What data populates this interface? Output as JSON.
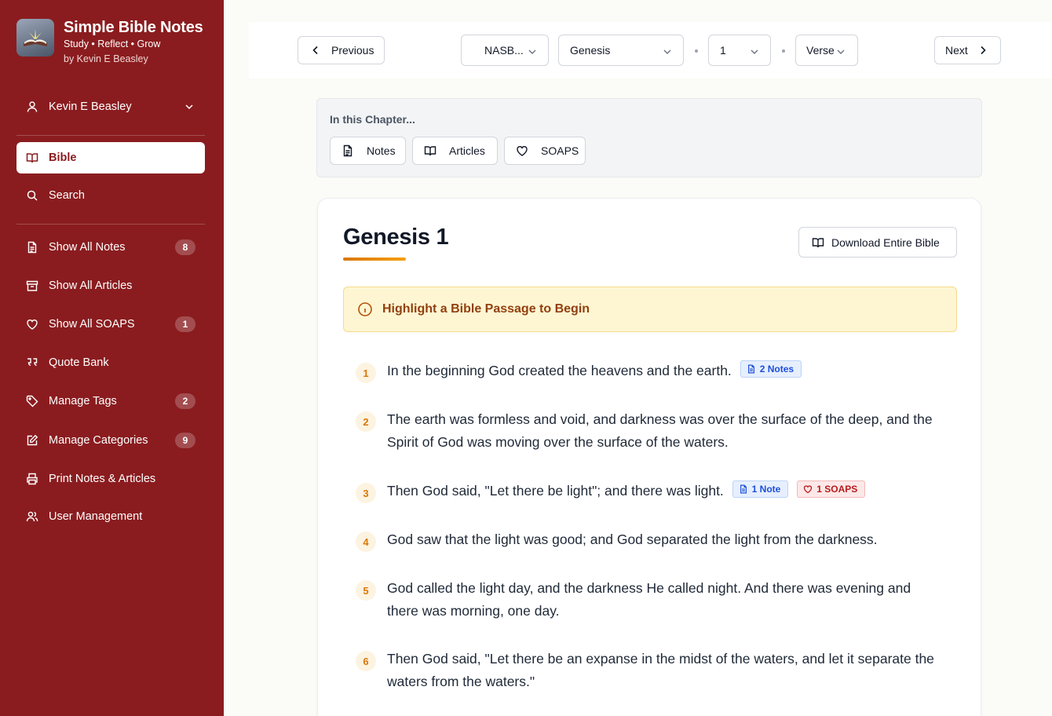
{
  "app": {
    "title": "Simple Bible Notes",
    "tagline": "Study • Reflect • Grow",
    "author": "by Kevin E Beasley"
  },
  "sidebar": {
    "user": "Kevin E Beasley",
    "items": [
      {
        "label": "Bible",
        "icon": "book-open-icon",
        "active": true
      },
      {
        "label": "Search",
        "icon": "search-icon"
      },
      {
        "label": "Show All Notes",
        "icon": "file-text-icon",
        "badge": "8"
      },
      {
        "label": "Show All Articles",
        "icon": "archive-icon"
      },
      {
        "label": "Show All SOAPS",
        "icon": "heart-icon",
        "badge": "1"
      },
      {
        "label": "Quote Bank",
        "icon": "quote-icon"
      },
      {
        "label": "Manage Tags",
        "icon": "tag-icon",
        "badge": "2"
      },
      {
        "label": "Manage Categories",
        "icon": "edit-icon",
        "badge": "9"
      },
      {
        "label": "Print Notes & Articles",
        "icon": "printer-icon"
      },
      {
        "label": "User Management",
        "icon": "users-icon"
      }
    ]
  },
  "nav": {
    "previous": "Previous",
    "next": "Next",
    "version": "NASB...",
    "book": "Genesis",
    "chapter": "1",
    "verse": "Verse"
  },
  "chapter_panel": {
    "title": "In this Chapter...",
    "chips": [
      "Notes",
      "Articles",
      "SOAPS"
    ]
  },
  "main": {
    "heading": "Genesis 1",
    "download_label": "Download Entire Bible",
    "alert": "Highlight a Bible Passage to Begin",
    "verses": [
      {
        "num": "1",
        "text": "In the beginning God created the heavens and the earth.",
        "note_tag": "2 Notes"
      },
      {
        "num": "2",
        "text": "The earth was formless and void, and darkness was over the surface of the deep, and the Spirit of God was moving over the surface of the waters."
      },
      {
        "num": "3",
        "text": "Then God said, \"Let there be light\"; and there was light.",
        "note_tag": "1 Note",
        "soap_tag": "1 SOAPS"
      },
      {
        "num": "4",
        "text": "God saw that the light was good; and God separated the light from the darkness."
      },
      {
        "num": "5",
        "text": "God called the light day, and the darkness He called night. And there was evening and there was morning, one day."
      },
      {
        "num": "6",
        "text": "Then God said, \"Let there be an expanse in the midst of the waters, and let it separate the waters from the waters.\""
      }
    ]
  },
  "colors": {
    "sidebar_bg": "#8a1c1f",
    "accent": "#d97706",
    "alert_bg": "#fef6d3"
  }
}
